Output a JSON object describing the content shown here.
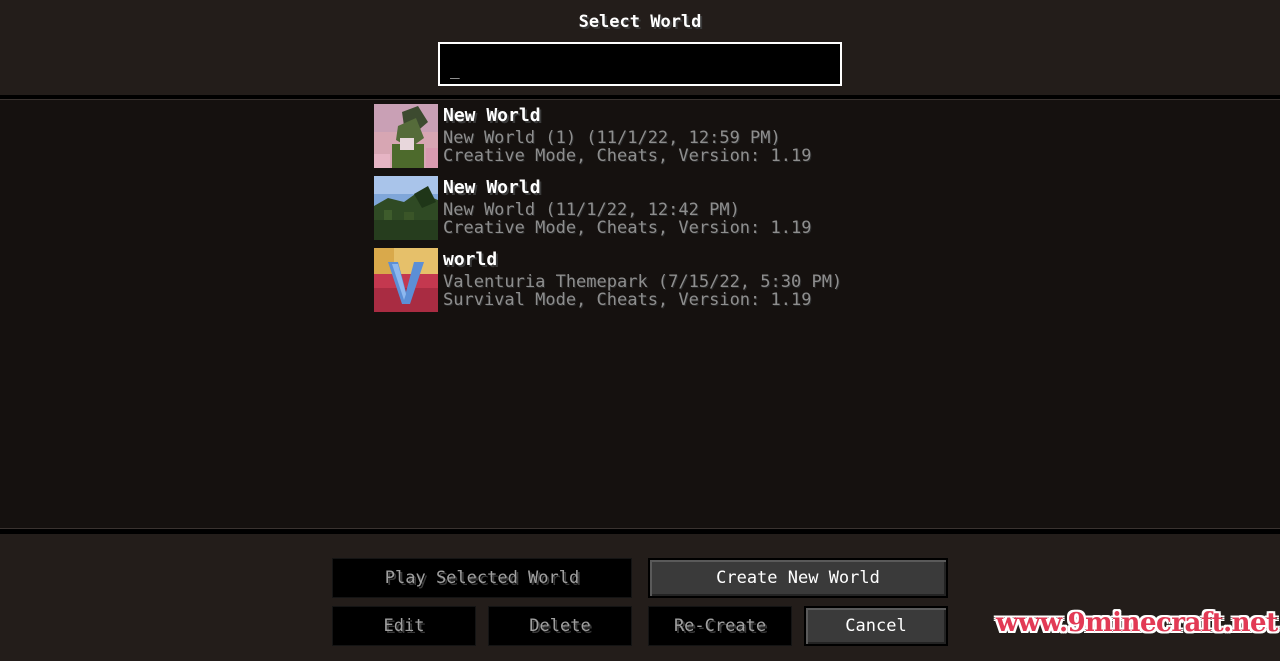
{
  "screen": {
    "title": "Select World"
  },
  "search": {
    "value": "_"
  },
  "worlds": [
    {
      "name": "New World",
      "folder_and_date": "New World (1) (11/1/22, 12:59 PM)",
      "details": "Creative Mode, Cheats, Version: 1.19",
      "thumbnail": "cherry-grove-thumbnail"
    },
    {
      "name": "New World",
      "folder_and_date": "New World (11/1/22, 12:42 PM)",
      "details": "Creative Mode, Cheats, Version: 1.19",
      "thumbnail": "jungle-thumbnail"
    },
    {
      "name": "world",
      "folder_and_date": "Valenturia Themepark (7/15/22, 5:30 PM)",
      "details": "Survival Mode, Cheats, Version: 1.19",
      "thumbnail": "valenturia-v-logo-thumbnail"
    }
  ],
  "buttons": {
    "play_selected": "Play Selected World",
    "create_new": "Create New World",
    "edit": "Edit",
    "delete": "Delete",
    "recreate": "Re-Create",
    "cancel": "Cancel"
  },
  "watermark": "www.9minecraft.net",
  "colors": {
    "header_bg": "#231d1a",
    "list_bg": "#15110f",
    "subtext": "#8e8e8e",
    "watermark": "#e23a55"
  }
}
